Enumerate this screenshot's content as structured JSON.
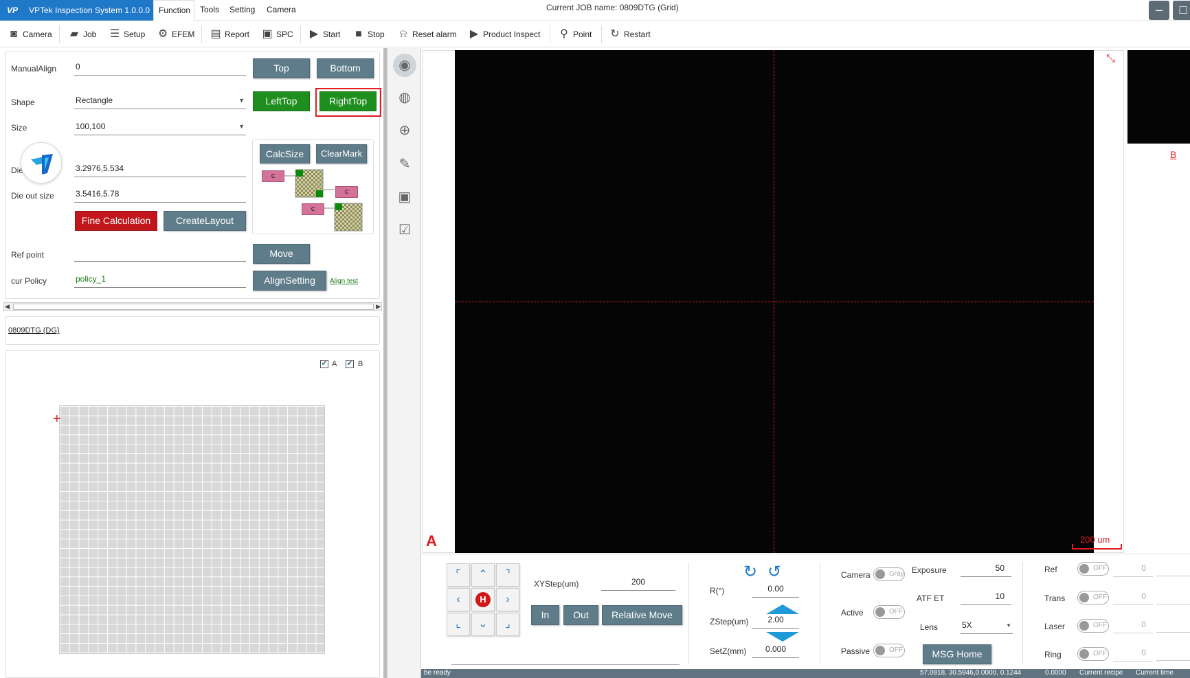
{
  "app": {
    "logo_text": "VP",
    "title": "VPTek Inspection System 1.0.0.0",
    "job_label": "Current JOB name:  0809DTG (Grid)"
  },
  "menu": [
    "Function",
    "Tools",
    "Setting",
    "Camera"
  ],
  "toolbar": [
    {
      "icon": "camera-icon",
      "label": "Camera"
    },
    {
      "icon": "briefcase-icon",
      "label": "Job"
    },
    {
      "icon": "checklist-icon",
      "label": "Setup"
    },
    {
      "icon": "robot-arm-icon",
      "label": "EFEM"
    },
    {
      "icon": "report-icon",
      "label": "Report"
    },
    {
      "icon": "spc-icon",
      "label": "SPC"
    },
    {
      "icon": "play-icon",
      "label": "Start"
    },
    {
      "icon": "stop-icon",
      "label": "Stop"
    },
    {
      "icon": "bell-off-icon",
      "label": "Reset alarm"
    },
    {
      "icon": "play-icon",
      "label": "Product Inspect"
    },
    {
      "icon": "map-pin-icon",
      "label": "Point"
    },
    {
      "icon": "refresh-icon",
      "label": "Restart"
    }
  ],
  "align_panel": {
    "manual_align_label": "ManualAlign",
    "manual_align_value": "0",
    "shape_label": "Shape",
    "shape_value": "Rectangle",
    "size_label": "Size",
    "size_value": "100,100",
    "die_label": "Die",
    "die_value": "3.2976,5.534",
    "die_out_label": "Die out size",
    "die_out_value": "3.5416,5.78",
    "ref_point_label": "Ref point",
    "ref_point_value": "",
    "cur_policy_label": "cur Policy",
    "cur_policy_value": "policy_1",
    "btn_top": "Top",
    "btn_bottom": "Bottom",
    "btn_lefttop": "LeftTop",
    "btn_righttop": "RightTop",
    "btn_calcsize": "CalcSize",
    "btn_clearmark": "ClearMark",
    "btn_fine": "Fine Calculation",
    "btn_create_layout": "CreateLayout",
    "btn_move": "Move",
    "btn_align_setting": "AlignSetting",
    "align_test_link": "Align test",
    "diagram_c": "c"
  },
  "wafer_panel": {
    "job_link": "0809DTG (DG)",
    "check_a_label": "A",
    "check_b_label": "B",
    "check_a": true,
    "check_b": true
  },
  "viewer": {
    "label_a": "A",
    "label_b": "B",
    "scale_text": "200 um",
    "crosshair_color": "#e01b22"
  },
  "motion": {
    "xy_step_label": "XYStep(um)",
    "xy_step_value": "200",
    "btn_in": "In",
    "btn_out": "Out",
    "btn_relative_move": "Relative Move",
    "home_label": "H",
    "r_label": "R(°)",
    "r_value": "0.00",
    "zstep_label": "ZStep(um)",
    "zstep_value": "2.00",
    "setz_label": "SetZ(mm)",
    "setz_value": "0.000"
  },
  "camera_ctrl": {
    "camera_label": "Camera",
    "camera_toggle": "Gray",
    "active_label": "Active",
    "active_toggle": "OFF",
    "passive_label": "Passive",
    "passive_toggle": "OFF",
    "exposure_label": "Exposure",
    "exposure_value": "50",
    "atf_label": "ATF ET",
    "atf_value": "10",
    "lens_label": "Lens",
    "lens_value": "5X",
    "btn_msg_home": "MSG Home"
  },
  "lights": [
    {
      "label": "Ref",
      "toggle": "OFF",
      "value": "0"
    },
    {
      "label": "Trans",
      "toggle": "OFF",
      "value": "0"
    },
    {
      "label": "Laser",
      "toggle": "OFF",
      "value": "0"
    },
    {
      "label": "Ring",
      "toggle": "OFF",
      "value": "0"
    }
  ],
  "status": {
    "left": "be ready",
    "coords": "57.0818, 30.5946,0.0000, 0.1244",
    "z": "0.0000",
    "recipe": "Current recipe",
    "time": "Current time"
  },
  "colors": {
    "accent_blue": "#1f78c8",
    "green_button": "#1e8e1e",
    "red_button": "#c0161c",
    "gray_button": "#5f7c8a",
    "highlight_box": "#e01b22"
  }
}
